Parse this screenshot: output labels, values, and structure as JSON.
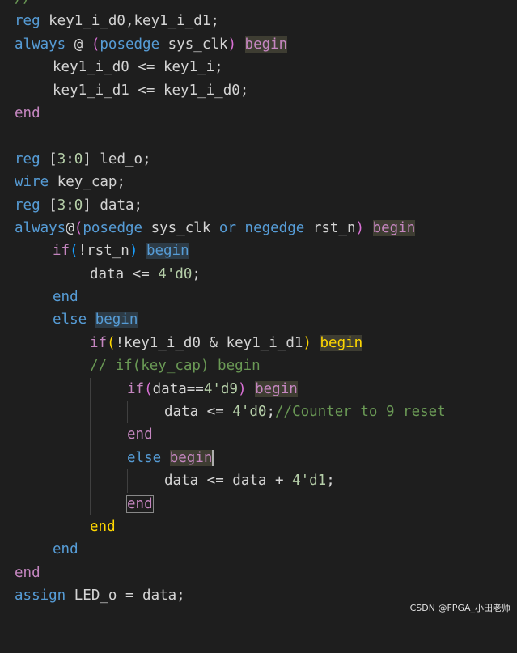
{
  "code": {
    "l0": {
      "t": "//"
    },
    "l1": {
      "a": "reg",
      "b": " key1_i_d0,key1_i_d1;"
    },
    "l2": {
      "a": "always",
      "b": " @ ",
      "c": "(",
      "d": "posedge",
      "e": " sys_clk",
      "f": ")",
      "g": " ",
      "h": "begin"
    },
    "l3": {
      "a": "key1_i_d0 <= key1_i;"
    },
    "l4": {
      "a": "key1_i_d1 <= key1_i_d0;"
    },
    "l5": {
      "a": "end"
    },
    "l6": {
      "a": ""
    },
    "l7": {
      "a": "reg",
      "b": " [",
      "c": "3",
      "d": ":",
      "e": "0",
      "f": "] led_o;"
    },
    "l8": {
      "a": "wire",
      "b": " key_cap;"
    },
    "l9": {
      "a": "reg",
      "b": " [",
      "c": "3",
      "d": ":",
      "e": "0",
      "f": "] data;"
    },
    "l10": {
      "a": "always",
      "b": "@",
      "c": "(",
      "d": "posedge",
      "e": " sys_clk ",
      "f": "or",
      "g": " ",
      "h": "negedge",
      "i": " rst_n",
      "j": ")",
      "k": " ",
      "l": "begin"
    },
    "l11": {
      "a": "if",
      "b": "(",
      "c": "!rst_n",
      "d": ")",
      "e": " ",
      "f": "begin"
    },
    "l12": {
      "a": "data <= ",
      "b": "4'd0",
      "c": ";"
    },
    "l13": {
      "a": "end"
    },
    "l14": {
      "a": "else",
      "b": " ",
      "c": "begin"
    },
    "l15": {
      "a": "if",
      "b": "(",
      "c": "!key1_i_d0 & key1_i_d1",
      "d": ")",
      "e": " ",
      "f": "begin"
    },
    "l16": {
      "a": "// if(key_cap) begin"
    },
    "l17": {
      "a": "if",
      "b": "(",
      "c": "data==",
      "d": "4'd9",
      "e": ")",
      "f": " ",
      "g": "begin"
    },
    "l18": {
      "a": "data <= ",
      "b": "4'd0",
      "c": ";",
      "d": "//Counter to 9 reset"
    },
    "l19": {
      "a": "end"
    },
    "l20": {
      "a": "else",
      "b": " ",
      "c": "begin"
    },
    "l21": {
      "a": "data <= data + ",
      "b": "4'd1",
      "c": ";"
    },
    "l22": {
      "a": "end"
    },
    "l23": {
      "a": "end"
    },
    "l24": {
      "a": "end"
    },
    "l25": {
      "a": "end"
    },
    "l26": {
      "a": "assign",
      "b": " LED_o = data;"
    }
  },
  "watermark": "CSDN @FPGA_小田老师"
}
